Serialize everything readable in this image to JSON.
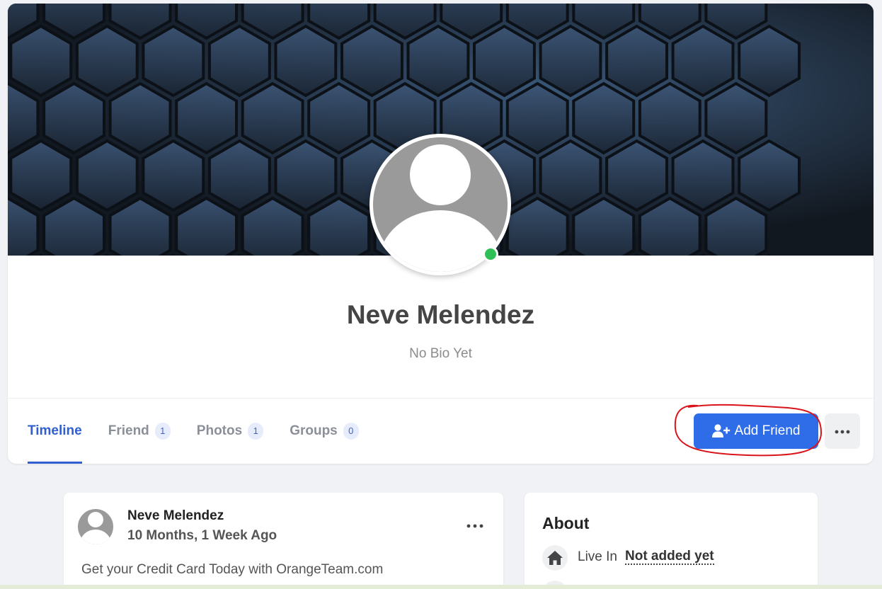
{
  "profile": {
    "name": "Neve Melendez",
    "bio": "No Bio Yet",
    "online": true
  },
  "tabs": [
    {
      "label": "Timeline",
      "count": null,
      "active": true
    },
    {
      "label": "Friend",
      "count": "1"
    },
    {
      "label": "Photos",
      "count": "1"
    },
    {
      "label": "Groups",
      "count": "0"
    }
  ],
  "actions": {
    "add_friend_label": "Add Friend",
    "add_friend_icon": "user-plus-icon",
    "more_icon": "ellipsis-icon"
  },
  "post": {
    "author": "Neve Melendez",
    "time": "10 Months, 1 Week Ago",
    "text": "Get your Credit Card Today with OrangeTeam.com"
  },
  "about": {
    "title": "About",
    "items": [
      {
        "icon": "home-icon",
        "label": "Live In",
        "value": "Not added yet"
      }
    ]
  },
  "colors": {
    "accent": "#2f6de8",
    "tab_active": "#2f5fd0",
    "online": "#2fbf57",
    "annotation": "#d9141b"
  }
}
